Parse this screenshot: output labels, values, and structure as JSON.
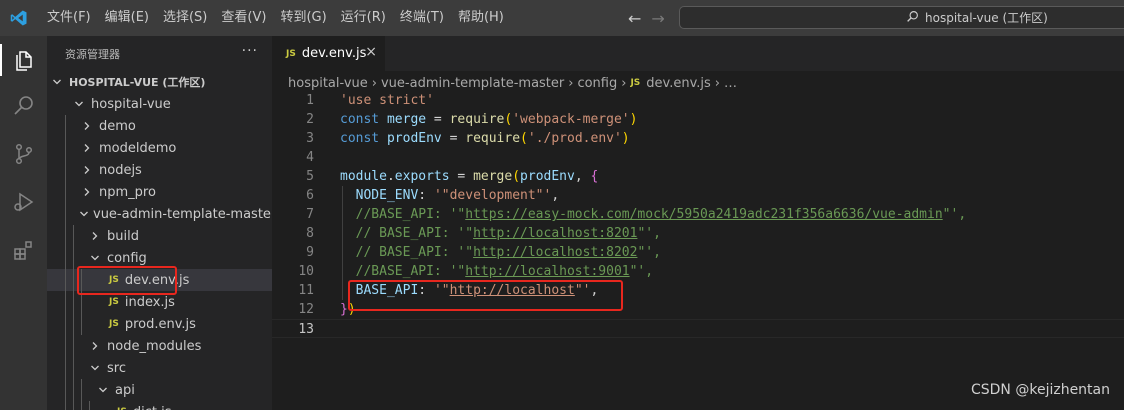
{
  "menu": [
    "文件(F)",
    "编辑(E)",
    "选择(S)",
    "查看(V)",
    "转到(G)",
    "运行(R)",
    "终端(T)",
    "帮助(H)"
  ],
  "command_center": {
    "text": "hospital-vue (工作区)"
  },
  "nav": {
    "back": "←",
    "forward": "→"
  },
  "sidebar": {
    "title": "资源管理器",
    "more": "···",
    "workspace": "HOSPITAL-VUE (工作区)",
    "tree": [
      {
        "label": "hospital-vue",
        "level": 1,
        "type": "folder-open"
      },
      {
        "label": "demo",
        "level": 2,
        "type": "folder"
      },
      {
        "label": "modeldemo",
        "level": 2,
        "type": "folder"
      },
      {
        "label": "nodejs",
        "level": 2,
        "type": "folder"
      },
      {
        "label": "npm_pro",
        "level": 2,
        "type": "folder"
      },
      {
        "label": "vue-admin-template-master",
        "level": 2,
        "type": "folder-open"
      },
      {
        "label": "build",
        "level": 3,
        "type": "folder"
      },
      {
        "label": "config",
        "level": 3,
        "type": "folder-open"
      },
      {
        "label": "dev.env.js",
        "level": 4,
        "type": "js",
        "selected": true
      },
      {
        "label": "index.js",
        "level": 4,
        "type": "js"
      },
      {
        "label": "prod.env.js",
        "level": 4,
        "type": "js"
      },
      {
        "label": "node_modules",
        "level": 3,
        "type": "folder"
      },
      {
        "label": "src",
        "level": 3,
        "type": "folder-open"
      },
      {
        "label": "api",
        "level": 4,
        "type": "folder-open"
      },
      {
        "label": "dict.js",
        "level": 5,
        "type": "js"
      }
    ]
  },
  "tab": {
    "badge": "JS",
    "label": "dev.env.js",
    "close": "×"
  },
  "breadcrumb": {
    "items": [
      "hospital-vue",
      "vue-admin-template-master",
      "config"
    ],
    "file": "dev.env.js",
    "more": "…",
    "badge": "JS"
  },
  "editor": {
    "current_line": 13,
    "lines": [
      {
        "n": "1",
        "tokens": [
          [
            "s",
            "'use strict'"
          ]
        ]
      },
      {
        "n": "2",
        "tokens": [
          [
            "k",
            "const "
          ],
          [
            "v",
            "merge"
          ],
          [
            "p",
            " = "
          ],
          [
            "f",
            "require"
          ],
          [
            "y",
            "("
          ],
          [
            "s",
            "'webpack-merge'"
          ],
          [
            "y",
            ")"
          ]
        ]
      },
      {
        "n": "3",
        "tokens": [
          [
            "k",
            "const "
          ],
          [
            "v",
            "prodEnv"
          ],
          [
            "p",
            " = "
          ],
          [
            "f",
            "require"
          ],
          [
            "y",
            "("
          ],
          [
            "s",
            "'./prod.env'"
          ],
          [
            "y",
            ")"
          ]
        ]
      },
      {
        "n": "4",
        "tokens": []
      },
      {
        "n": "5",
        "tokens": [
          [
            "v",
            "module"
          ],
          [
            "p",
            "."
          ],
          [
            "v",
            "exports"
          ],
          [
            "p",
            " = "
          ],
          [
            "f",
            "merge"
          ],
          [
            "y",
            "("
          ],
          [
            "v",
            "prodEnv"
          ],
          [
            "p",
            ", "
          ],
          [
            "m",
            "{"
          ]
        ]
      },
      {
        "n": "6",
        "tokens": [
          [
            "p",
            "  "
          ],
          [
            "v",
            "NODE_ENV"
          ],
          [
            "p",
            ": "
          ],
          [
            "s",
            "'\"development\"'"
          ],
          [
            "p",
            ","
          ]
        ]
      },
      {
        "n": "7",
        "tokens": [
          [
            "c",
            "  //BASE_API: '\""
          ],
          [
            "cu",
            "https://easy-mock.com/mock/5950a2419adc231f356a6636/vue-admin"
          ],
          [
            "c",
            "\"',"
          ]
        ]
      },
      {
        "n": "8",
        "tokens": [
          [
            "c",
            "  // BASE_API: '\""
          ],
          [
            "cu",
            "http://localhost:8201"
          ],
          [
            "c",
            "\"',"
          ]
        ]
      },
      {
        "n": "9",
        "tokens": [
          [
            "c",
            "  // BASE_API: '\""
          ],
          [
            "cu",
            "http://localhost:8202"
          ],
          [
            "c",
            "\"',"
          ]
        ]
      },
      {
        "n": "10",
        "tokens": [
          [
            "c",
            "  //BASE_API: '\""
          ],
          [
            "cu",
            "http://localhost:9001"
          ],
          [
            "c",
            "\"',"
          ]
        ]
      },
      {
        "n": "11",
        "tokens": [
          [
            "p",
            "  "
          ],
          [
            "v",
            "BASE_API"
          ],
          [
            "p",
            ": "
          ],
          [
            "s",
            "'\""
          ],
          [
            "su",
            "http://localhost"
          ],
          [
            "s",
            "\"'"
          ],
          [
            "p",
            ","
          ]
        ]
      },
      {
        "n": "12",
        "tokens": [
          [
            "m",
            "}"
          ],
          [
            "y",
            ")"
          ]
        ]
      },
      {
        "n": "13",
        "tokens": []
      }
    ]
  },
  "watermark": "CSDN @kejizhentan",
  "colors": {
    "highlight_box": "#e8271e",
    "accent": "#007acc",
    "js_badge": "#cbcb41"
  }
}
